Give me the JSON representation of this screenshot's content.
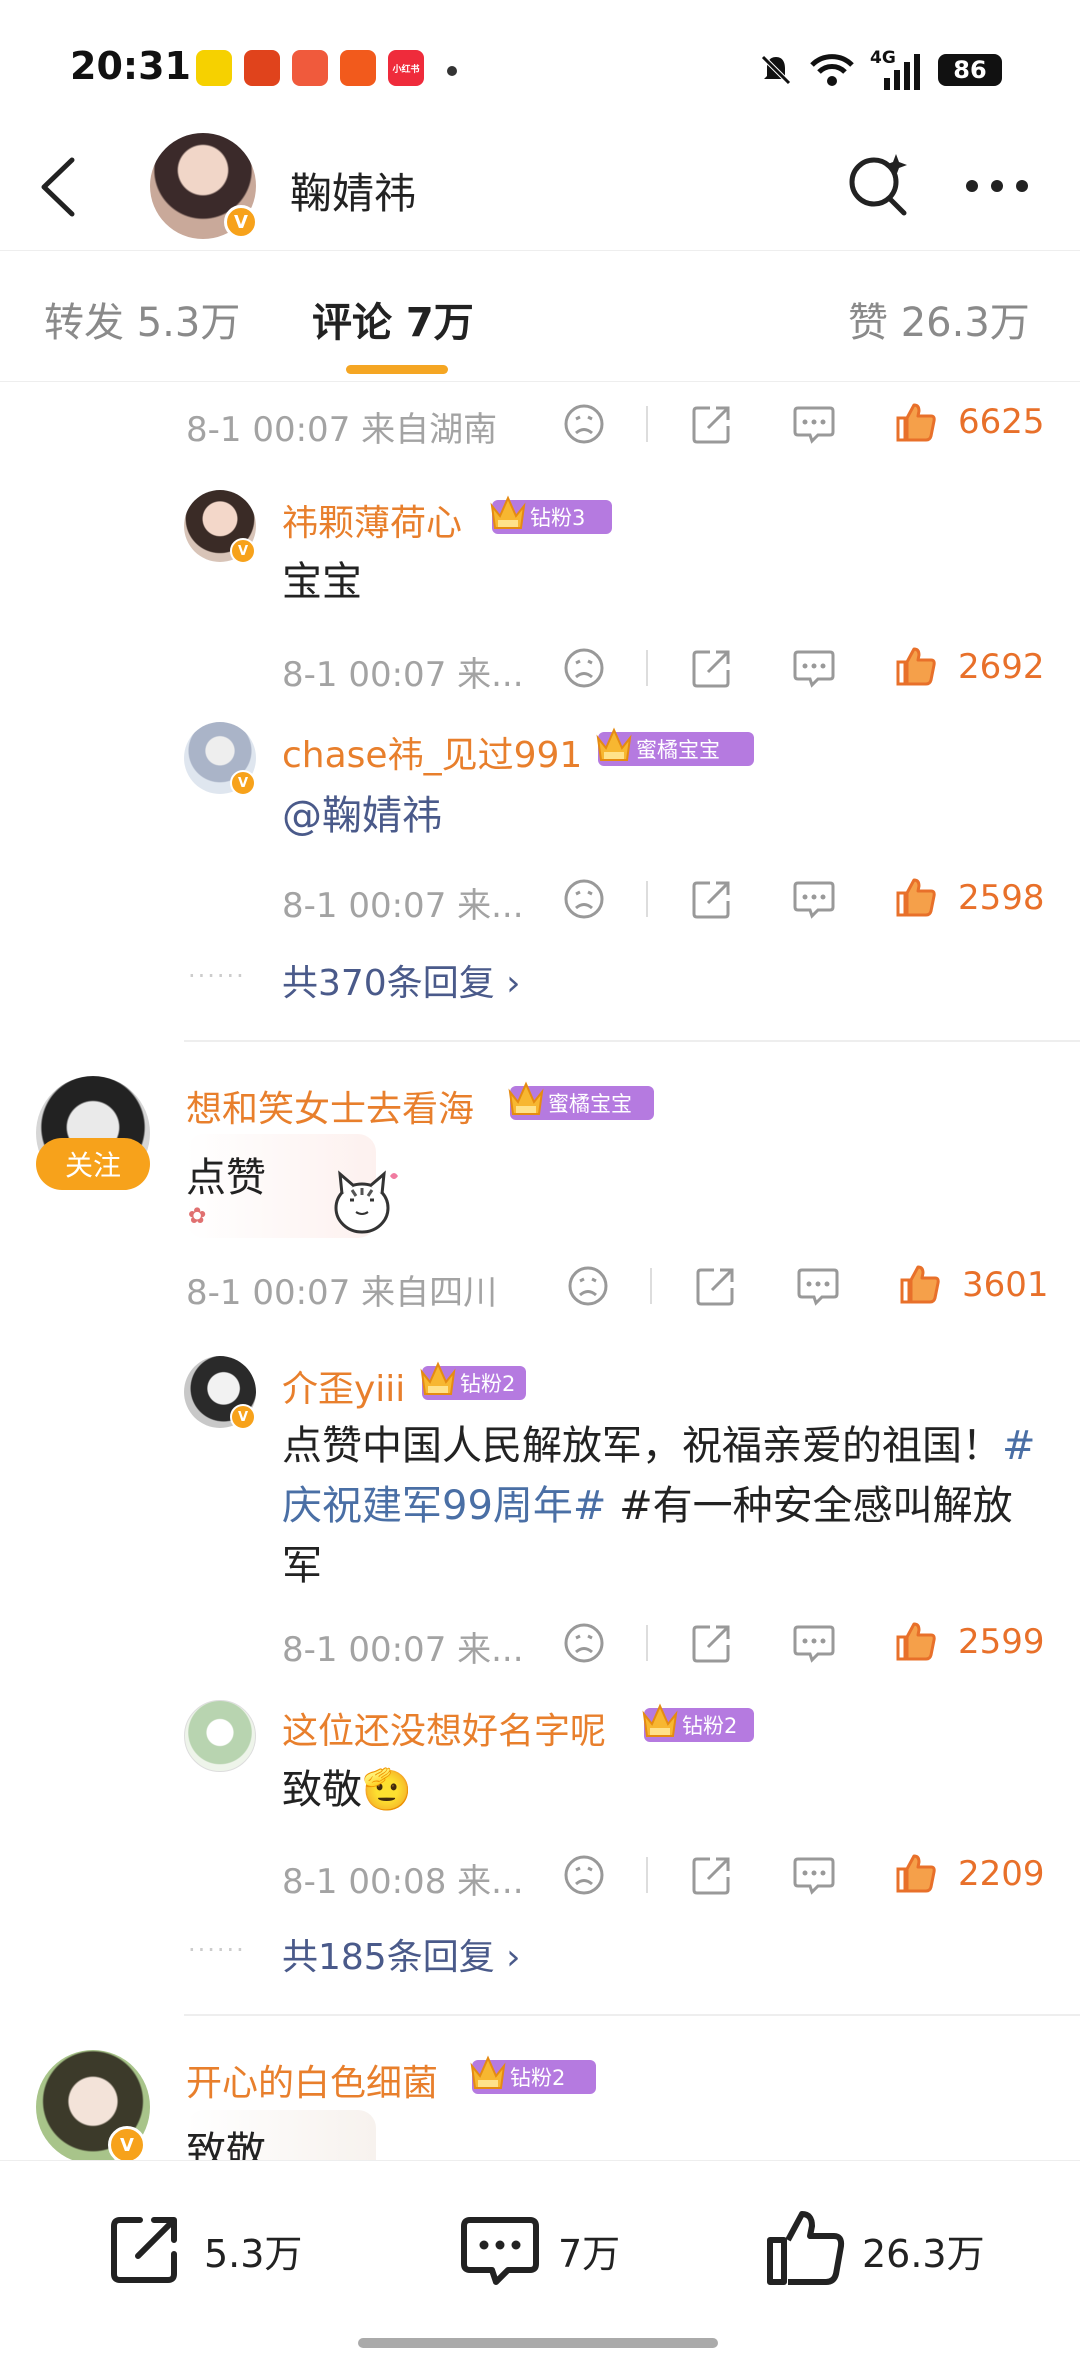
{
  "status": {
    "time": "20:31",
    "battery": "86",
    "network": "4G",
    "apps": [
      {
        "label": "快团"
      },
      {
        "label": "淘"
      },
      {
        "label": "拼"
      },
      {
        "label": "支"
      },
      {
        "label": "小红书"
      }
    ]
  },
  "header": {
    "title": "鞠婧祎",
    "badge": "V"
  },
  "tabs": {
    "repost": "转发 5.3万",
    "comments": "评论 7万",
    "likes": "赞 26.3万"
  },
  "comments": [
    {
      "meta": "8-1 00:07  来自湖南",
      "likes": "6625",
      "replies": [
        {
          "name": "祎颗薄荷心",
          "badge": "钻粉3",
          "text": "宝宝",
          "meta": "8-1 00:07  来...",
          "likes": "2692"
        },
        {
          "name": "chase祎_见过991",
          "badge": "蜜橘宝宝",
          "text": "@鞠婧祎",
          "meta": "8-1 00:07  来...",
          "likes": "2598"
        }
      ],
      "more": "共370条回复 ›"
    },
    {
      "name": "想和笑女士去看海",
      "badge": "蜜橘宝宝",
      "follow": "关注",
      "text": "点赞",
      "meta": "8-1 00:07  来自四川",
      "likes": "3601",
      "replies": [
        {
          "name": "介歪yiii",
          "badge": "钻粉2",
          "text_a": "点赞中国人民解放军，祝福亲爱的祖国！",
          "hashtag": "#庆祝建军99周年#",
          "text_b": " #有一种安全感叫解放军",
          "meta": "8-1 00:07  来...",
          "likes": "2599"
        },
        {
          "name": "这位还没想好名字呢",
          "badge": "钻粉2",
          "text": "致敬",
          "emoji": "🫡",
          "meta": "8-1 00:08  来...",
          "likes": "2209"
        }
      ],
      "more": "共185条回复 ›"
    },
    {
      "name": "开心的白色细菌",
      "badge": "钻粉2",
      "text": "致敬"
    }
  ],
  "bottom": {
    "repost": "5.3万",
    "comment": "7万",
    "like": "26.3万"
  },
  "colors": {
    "accent": "#f7a21b",
    "name": "#e87f2c",
    "like": "#e8702a",
    "link": "#4a5a8a",
    "badge_purple": "#b57ae0"
  }
}
